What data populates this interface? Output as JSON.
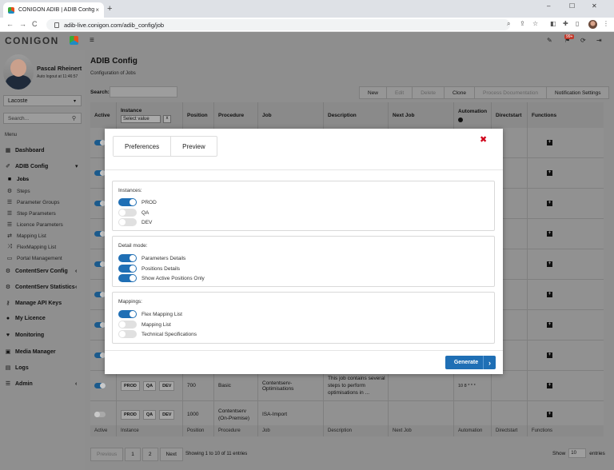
{
  "browser": {
    "tab_title": "CONIGON ADIB | ADIB Config",
    "tab_close": "×",
    "new_tab": "+",
    "url": "adib-live.conigon.com/adib_config/job",
    "min": "–",
    "max": "☐",
    "close": "✕",
    "back": "←",
    "forward": "→",
    "reload": "C"
  },
  "header": {
    "logo": "CONIGON",
    "menu_icon": "≡",
    "notif_badge": "99+"
  },
  "user": {
    "name": "Pascal Rheinert",
    "logout": "Auto logout at 11:46:57"
  },
  "sidebar": {
    "client": "Lacoste",
    "search_placeholder": "Search...",
    "menu_label": "Menu",
    "dashboard": "Dashboard",
    "adib_config": "ADIB Config",
    "sub": {
      "jobs": "Jobs",
      "steps": "Steps",
      "parameter_groups": "Parameter Groups",
      "step_parameters": "Step Parameters",
      "licence_parameters": "Licence Parameters",
      "mapping_list": "Mapping List",
      "flexmapping_list": "FlexMapping List",
      "portal_management": "Portal Management"
    },
    "contentserv_config": "ContentServ Config",
    "contentserv_statistics": "ContentServ Statistics",
    "manage_api_keys": "Manage API Keys",
    "my_licence": "My Licence",
    "monitoring": "Monitoring",
    "media_manager": "Media Manager",
    "logs": "Logs",
    "admin": "Admin"
  },
  "main": {
    "title": "ADIB Config",
    "subtitle": "Configuration of Jobs",
    "search_label": "Search:",
    "buttons": {
      "new": "New",
      "edit": "Edit",
      "delete": "Delete",
      "clone": "Clone",
      "process_doc": "Process Documentation",
      "notif": "Notification Settings"
    },
    "columns": {
      "active": "Active",
      "instance": "Instance",
      "position": "Position",
      "procedure": "Procedure",
      "job": "Job",
      "description": "Description",
      "next_job": "Next Job",
      "automation": "Automation",
      "directstart": "Directstart",
      "functions": "Functions"
    },
    "instance_select": "Select value",
    "instance_clear": "x",
    "row_a": {
      "prod": "PROD",
      "qa": "QA",
      "dev": "DEV",
      "position": "700",
      "procedure": "Basic",
      "job": "Contentserv-Optimisations",
      "description": "This job contains several steps to perform optimisations in ...",
      "automation": "10 8 * * *"
    },
    "row_b": {
      "prod": "PROD",
      "qa": "QA",
      "dev": "DEV",
      "position": "1000",
      "procedure": "Contentserv (On-Premise)",
      "job": "ISA-Import"
    },
    "pager": {
      "previous": "Previous",
      "p1": "1",
      "p2": "2",
      "next": "Next"
    },
    "showing": "Showing 1 to 10 of 11 entries",
    "show_label": "Show",
    "show_value": "10",
    "entries_label": "entries"
  },
  "modal": {
    "tab_preferences": "Preferences",
    "tab_preview": "Preview",
    "close": "✖",
    "instances_title": "Instances:",
    "instances": [
      {
        "label": "PROD",
        "on": true
      },
      {
        "label": "QA",
        "on": false
      },
      {
        "label": "DEV",
        "on": false
      }
    ],
    "detail_title": "Detail mode:",
    "details": [
      {
        "label": "Parameters Details",
        "on": true
      },
      {
        "label": "Positions Details",
        "on": true
      },
      {
        "label": "Show Active Positions Only",
        "on": true
      }
    ],
    "mappings_title": "Mappings:",
    "mappings": [
      {
        "label": "Flex Mapping List",
        "on": true
      },
      {
        "label": "Mapping List",
        "on": false
      },
      {
        "label": "Technical Specifications",
        "on": false
      }
    ],
    "generate": "Generate",
    "generate_arrow": "›"
  },
  "colors": {
    "accent": "#1f6fb5",
    "close_red": "#d0021b",
    "overlay_gray": "#8e8e8e"
  }
}
